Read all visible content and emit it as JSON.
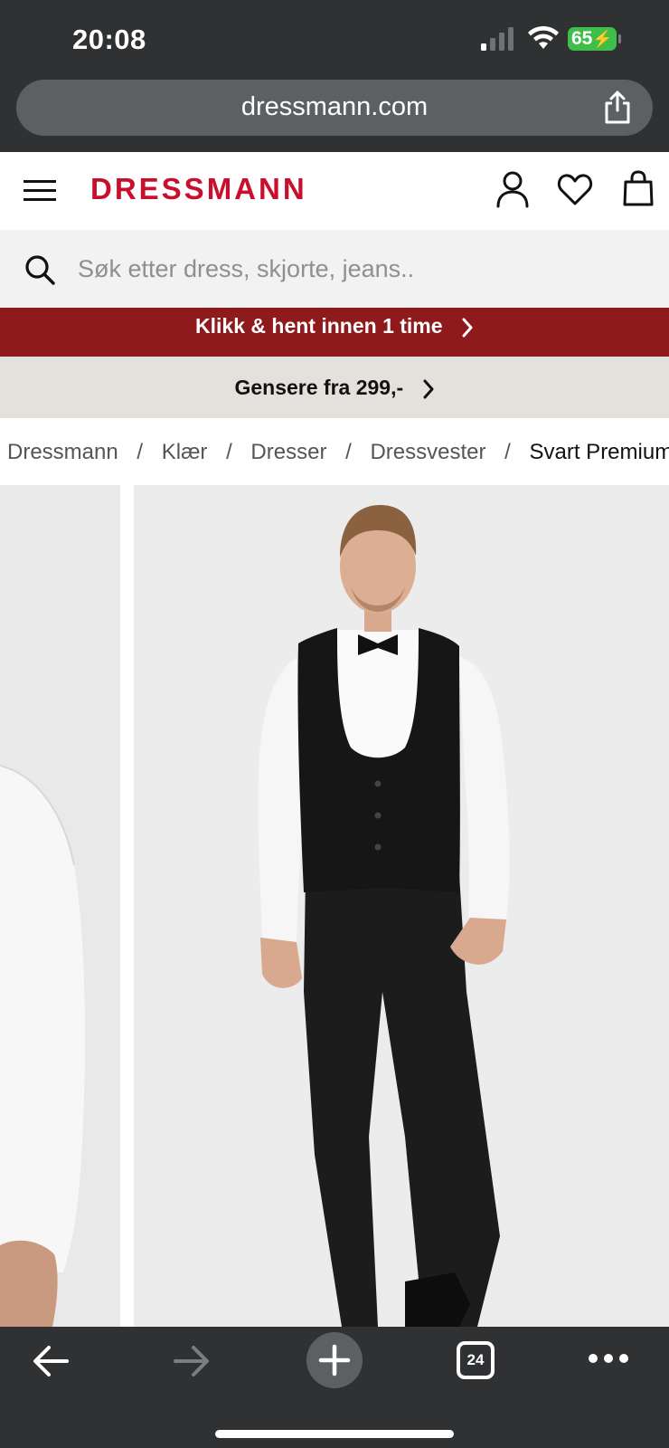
{
  "status_bar": {
    "time": "20:08",
    "battery": "65"
  },
  "browser": {
    "url": "dressmann.com",
    "tab_count": "24"
  },
  "header": {
    "logo": "DRESSMANN",
    "brand_color": "#c8102e"
  },
  "search": {
    "placeholder": "Søk etter dress, skjorte, jeans.."
  },
  "banners": {
    "promo_red": "Klikk & hent innen 1 time",
    "promo_grey": "Gensere fra 299,-",
    "red_color": "#8f1a1c"
  },
  "breadcrumb": {
    "items": [
      "Dressmann",
      "Klær",
      "Dresser",
      "Dressvester",
      "Svart Premium"
    ]
  },
  "icons": {
    "menu": "menu-icon",
    "account": "account-icon",
    "wishlist": "heart-icon",
    "cart": "bag-icon",
    "share": "share-icon",
    "search": "search-icon"
  }
}
